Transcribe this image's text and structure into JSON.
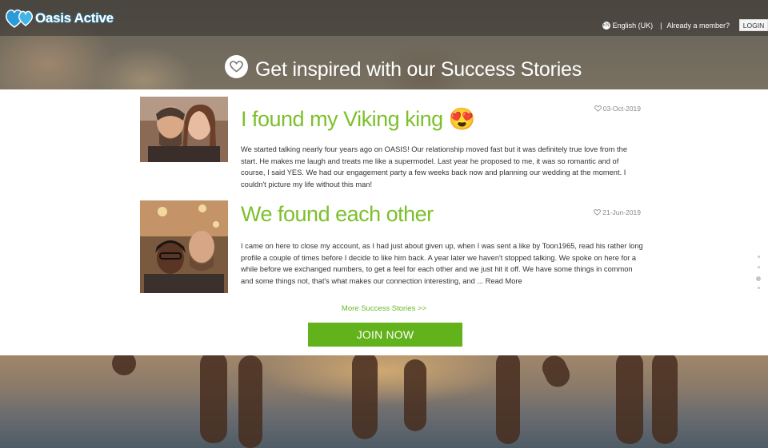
{
  "header": {
    "logo_text": "Oasis Active",
    "language": "English (UK)",
    "separator": "|",
    "already_member": "Already a member?",
    "login_label": "LOGIN"
  },
  "hero": {
    "title": "Get inspired with our Success Stories"
  },
  "stories": [
    {
      "title": "I found my Viking king 😍",
      "date": "03-Oct-2019",
      "body": "We started talking nearly four years ago on OASIS! Our relationship moved fast but it was definitely true love from the start. He makes me laugh and treats me like a supermodel. Last year he proposed to me, it was so romantic and of course, I said YES. We had our engagement party a few weeks back now and planning our wedding at the moment. I couldn't picture my life without this man!"
    },
    {
      "title": "We found each other",
      "date": "21-Jun-2019",
      "body": "I came on here to close my account, as I had just about given up, when I was sent a like by Toon1965, read his rather long profile a couple of times before I decide to like him back. A year later we haven't stopped talking. We spoke on here for a while before we exchanged numbers, to get a feel for each other and we just hit it off. We have some things in common and some things not, that's what makes our connection interesting, and ...",
      "read_more": "Read More"
    }
  ],
  "more_stories_link": "More Success Stories >>",
  "join_button": "JOIN NOW",
  "colors": {
    "accent_green": "#7cc02b",
    "button_green": "#62b21b",
    "logo_blue": "#2a9bd8"
  }
}
